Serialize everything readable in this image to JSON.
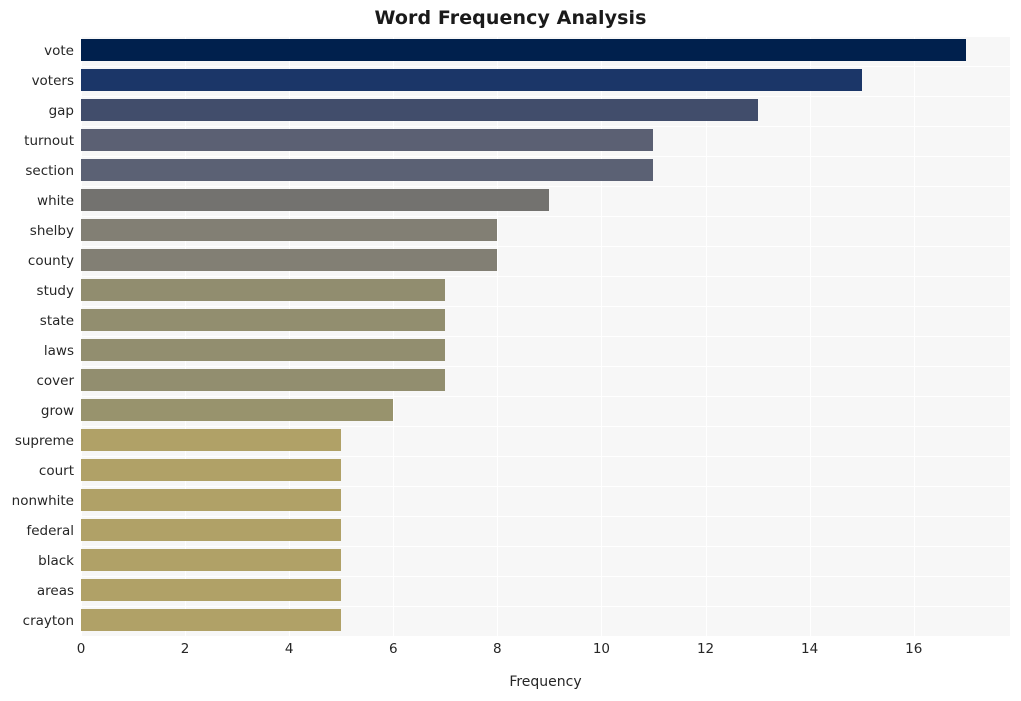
{
  "chart_data": {
    "type": "bar",
    "orientation": "horizontal",
    "title": "Word Frequency Analysis",
    "xlabel": "Frequency",
    "ylabel": "",
    "categories": [
      "vote",
      "voters",
      "gap",
      "turnout",
      "section",
      "white",
      "shelby",
      "county",
      "study",
      "state",
      "laws",
      "cover",
      "grow",
      "supreme",
      "court",
      "nonwhite",
      "federal",
      "black",
      "areas",
      "crayton"
    ],
    "values": [
      17,
      15,
      13,
      11,
      11,
      9,
      8,
      8,
      7,
      7,
      7,
      7,
      6,
      5,
      5,
      5,
      5,
      5,
      5,
      5
    ],
    "bar_colors": [
      "#00204d",
      "#1b3668",
      "#414d6b",
      "#5b6073",
      "#5b6174",
      "#73726f",
      "#827f74",
      "#827f74",
      "#918d6f",
      "#928e6f",
      "#928e6f",
      "#928e6f",
      "#98936d",
      "#b0a167",
      "#b0a167",
      "#b0a167",
      "#b0a167",
      "#b0a167",
      "#b0a167",
      "#b0a167"
    ],
    "xticks": [
      0,
      2,
      4,
      6,
      8,
      10,
      12,
      14,
      16
    ],
    "xlim": [
      0,
      17.85
    ],
    "grid": true,
    "grid_color": "#ffffff",
    "plot_background": "#f7f7f7",
    "legend": null,
    "colormap": "cividis"
  },
  "axes": {
    "x_axis_label": "Frequency",
    "x_tick_labels": [
      "0",
      "2",
      "4",
      "6",
      "8",
      "10",
      "12",
      "14",
      "16"
    ],
    "y_tick_labels": [
      "vote",
      "voters",
      "gap",
      "turnout",
      "section",
      "white",
      "shelby",
      "county",
      "study",
      "state",
      "laws",
      "cover",
      "grow",
      "supreme",
      "court",
      "nonwhite",
      "federal",
      "black",
      "areas",
      "crayton"
    ]
  },
  "header": {
    "title": "Word Frequency Analysis"
  }
}
